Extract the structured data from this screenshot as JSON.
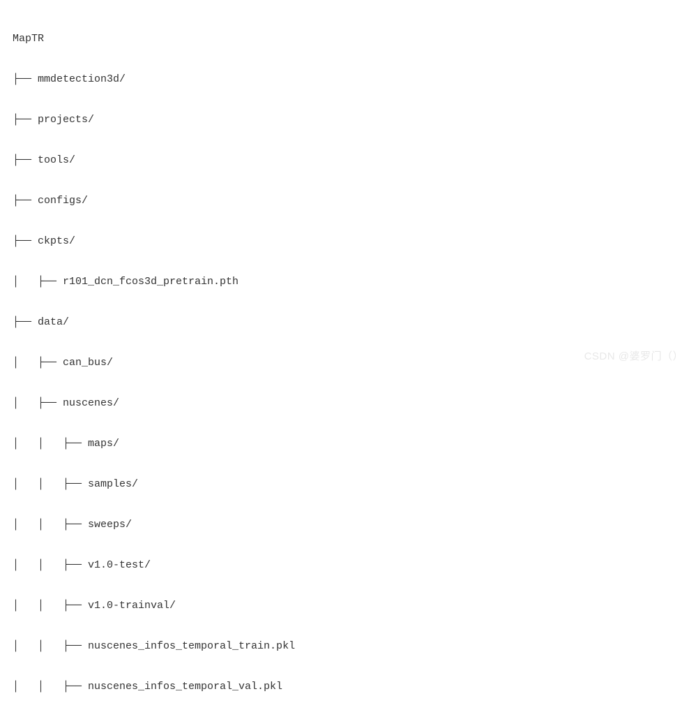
{
  "tree": {
    "root": "MapTR",
    "l1": "├── mmdetection3d/",
    "l2": "├── projects/",
    "l3": "├── tools/",
    "l4": "├── configs/",
    "l5": "├── ckpts/",
    "l6": "│   ├── r101_dcn_fcos3d_pretrain.pth",
    "l7": "├── data/",
    "l8": "│   ├── can_bus/",
    "l9": "│   ├── nuscenes/",
    "l10": "│   │   ├── maps/",
    "l11": "│   │   ├── samples/",
    "l12": "│   │   ├── sweeps/",
    "l13": "│   │   ├── v1.0-test/",
    "l14": "│   │   ├── v1.0-trainval/",
    "l15": "│   │   ├── nuscenes_infos_temporal_train.pkl",
    "l16": "│   │   ├── nuscenes_infos_temporal_val.pkl"
  },
  "watermark": "CSDN @婆罗门（）"
}
